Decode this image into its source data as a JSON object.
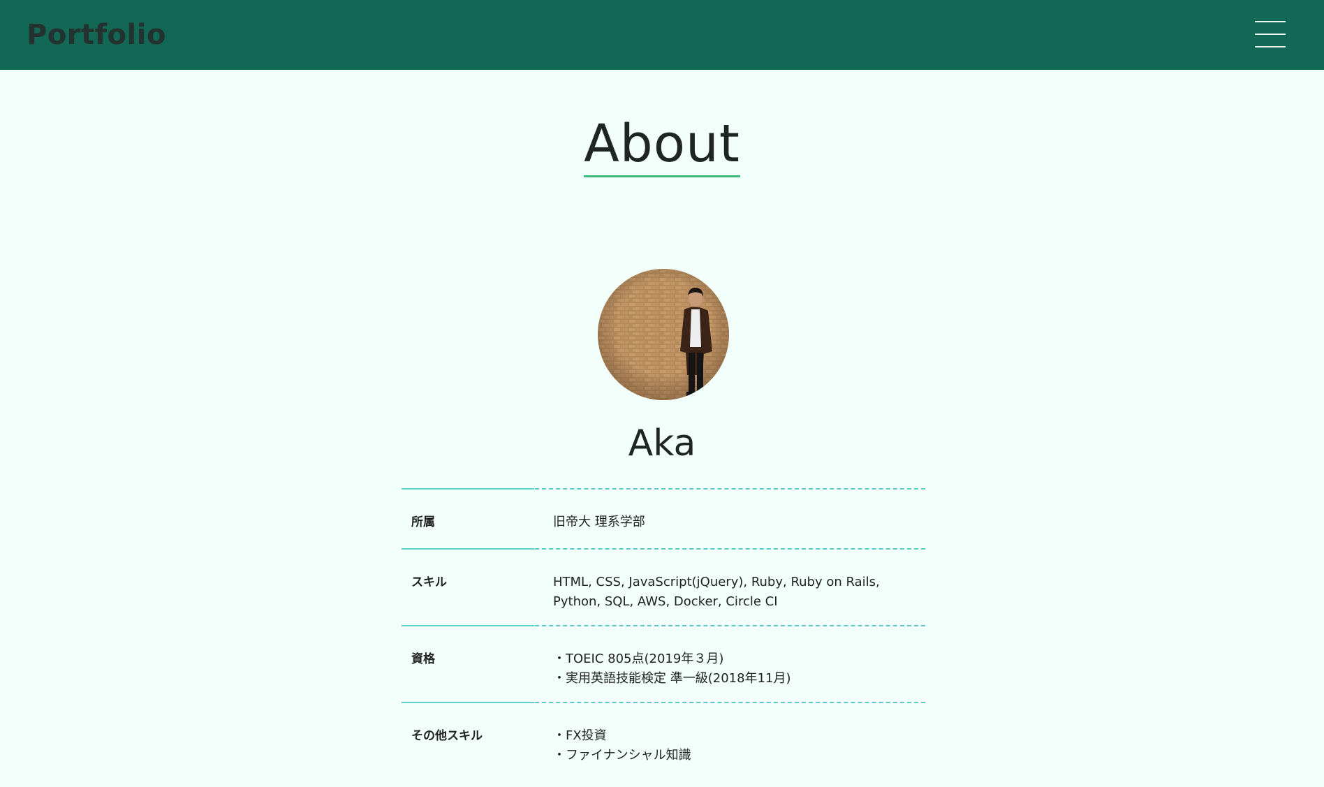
{
  "header": {
    "logo": "Portfolio",
    "menu_icon": "hamburger-menu-icon",
    "background_color": "#126755"
  },
  "section": {
    "title": "About",
    "underline_color": "#3cb97a"
  },
  "profile": {
    "name": "Aka",
    "photo": "profile-photo"
  },
  "info": {
    "affiliation": {
      "label": "所属",
      "value": "旧帝大 理系学部"
    },
    "skills": {
      "label": "スキル",
      "lines": [
        "HTML, CSS, JavaScript(jQuery), Ruby, Ruby on Rails,",
        "Python, SQL, AWS, Docker, Circle CI"
      ]
    },
    "certifications": {
      "label": "資格",
      "lines": [
        "・TOEIC 805点(2019年３月)",
        "・実用英語技能検定 準一級(2018年11月)"
      ]
    },
    "other_skills": {
      "label": "その他スキル",
      "lines": [
        "・FX投資",
        "・ファイナンシャル知識"
      ]
    }
  }
}
